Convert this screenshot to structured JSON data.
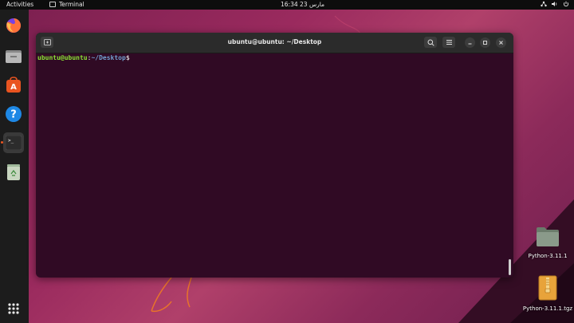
{
  "topbar": {
    "activities": "Activities",
    "app_name": "Terminal",
    "clock": "مارس 23  16:34"
  },
  "dock": {
    "items": [
      {
        "name": "Firefox",
        "icon": "firefox-icon"
      },
      {
        "name": "Files",
        "icon": "files-icon"
      },
      {
        "name": "Ubuntu Software",
        "icon": "software-icon"
      },
      {
        "name": "Help",
        "icon": "help-icon"
      },
      {
        "name": "Terminal",
        "icon": "terminal-icon",
        "active": true
      },
      {
        "name": "Trash",
        "icon": "trash-icon"
      },
      {
        "name": "Show Applications",
        "icon": "app-grid-icon"
      }
    ]
  },
  "terminal": {
    "title": "ubuntu@ubuntu: ~/Desktop",
    "prompt_user": "ubuntu@ubuntu",
    "prompt_sep": ":",
    "prompt_path": "~/Desktop",
    "prompt_symbol": "$"
  },
  "desktop": {
    "icons": [
      {
        "label": "Python-3.11.1",
        "icon": "folder-icon"
      },
      {
        "label": "Python-3.11.1.tgz",
        "icon": "archive-icon"
      }
    ]
  },
  "colors": {
    "accent": "#e95420",
    "terminal_bg": "#300a24",
    "prompt_user": "#8ae234",
    "prompt_path": "#729fcf"
  }
}
